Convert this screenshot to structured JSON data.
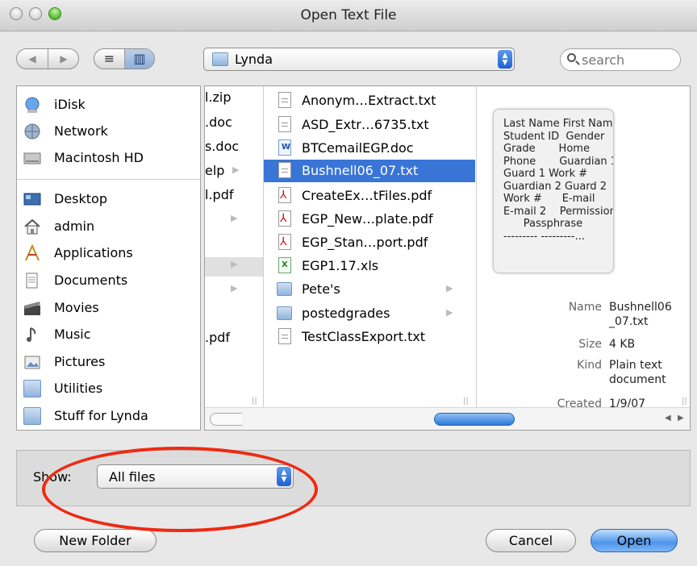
{
  "window": {
    "title": "Open Text File"
  },
  "toolbar": {
    "back_glyph": "◀",
    "forward_glyph": "▶",
    "list_view_glyph": "≡",
    "column_view_glyph": "▥",
    "location": "Lynda",
    "search_placeholder": "search"
  },
  "sidebar": {
    "devices": [
      {
        "label": "iDisk",
        "icon": "idisk-icon"
      },
      {
        "label": "Network",
        "icon": "network-icon"
      },
      {
        "label": "Macintosh HD",
        "icon": "harddrive-icon"
      }
    ],
    "places": [
      {
        "label": "Desktop",
        "icon": "desktop-icon"
      },
      {
        "label": "admin",
        "icon": "home-icon"
      },
      {
        "label": "Applications",
        "icon": "applications-icon"
      },
      {
        "label": "Documents",
        "icon": "documents-icon"
      },
      {
        "label": "Movies",
        "icon": "movies-icon"
      },
      {
        "label": "Music",
        "icon": "music-icon"
      },
      {
        "label": "Pictures",
        "icon": "pictures-icon"
      },
      {
        "label": "Utilities",
        "icon": "folder-icon"
      },
      {
        "label": "Stuff for Lynda",
        "icon": "folder-icon"
      }
    ]
  },
  "column1": {
    "items": [
      "l.zip",
      ".doc",
      "s.doc",
      "elp",
      "l.pdf",
      "",
      "",
      "",
      "",
      ".pdf"
    ]
  },
  "column2": {
    "items": [
      {
        "name": "Anonym…Extract.txt",
        "type": "txt"
      },
      {
        "name": "ASD_Extr…6735.txt",
        "type": "txt"
      },
      {
        "name": "BTCemailEGP.doc",
        "type": "doc"
      },
      {
        "name": "Bushnell06_07.txt",
        "type": "txt",
        "selected": true
      },
      {
        "name": "CreateEx…tFiles.pdf",
        "type": "pdf"
      },
      {
        "name": "EGP_New…plate.pdf",
        "type": "pdf"
      },
      {
        "name": "EGP_Stan…port.pdf",
        "type": "pdf"
      },
      {
        "name": "EGP1.17.xls",
        "type": "xls"
      },
      {
        "name": "Pete's",
        "type": "folder"
      },
      {
        "name": "postedgrades",
        "type": "folder"
      },
      {
        "name": "TestClassExport.txt",
        "type": "txt"
      }
    ]
  },
  "preview": {
    "text": "Last Name First Name\nStudent ID  Gender\nGrade       Home\nPhone       Guardian 1\nGuard 1 Work #\nGuardian 2 Guard 2\nWork #      E-mail\nE-mail 2    Permissions\n      Passphrase\n--------- ---------...",
    "name_label": "Name",
    "name_value_1": "Bushnell06",
    "name_value_2": "_07.txt",
    "size_label": "Size",
    "size_value": "4 KB",
    "kind_label": "Kind",
    "kind_value_1": "Plain text",
    "kind_value_2": "document",
    "created_label": "Created",
    "created_value": "1/9/07"
  },
  "show": {
    "label": "Show:",
    "value": "All files"
  },
  "buttons": {
    "new_folder": "New Folder",
    "cancel": "Cancel",
    "open": "Open"
  }
}
